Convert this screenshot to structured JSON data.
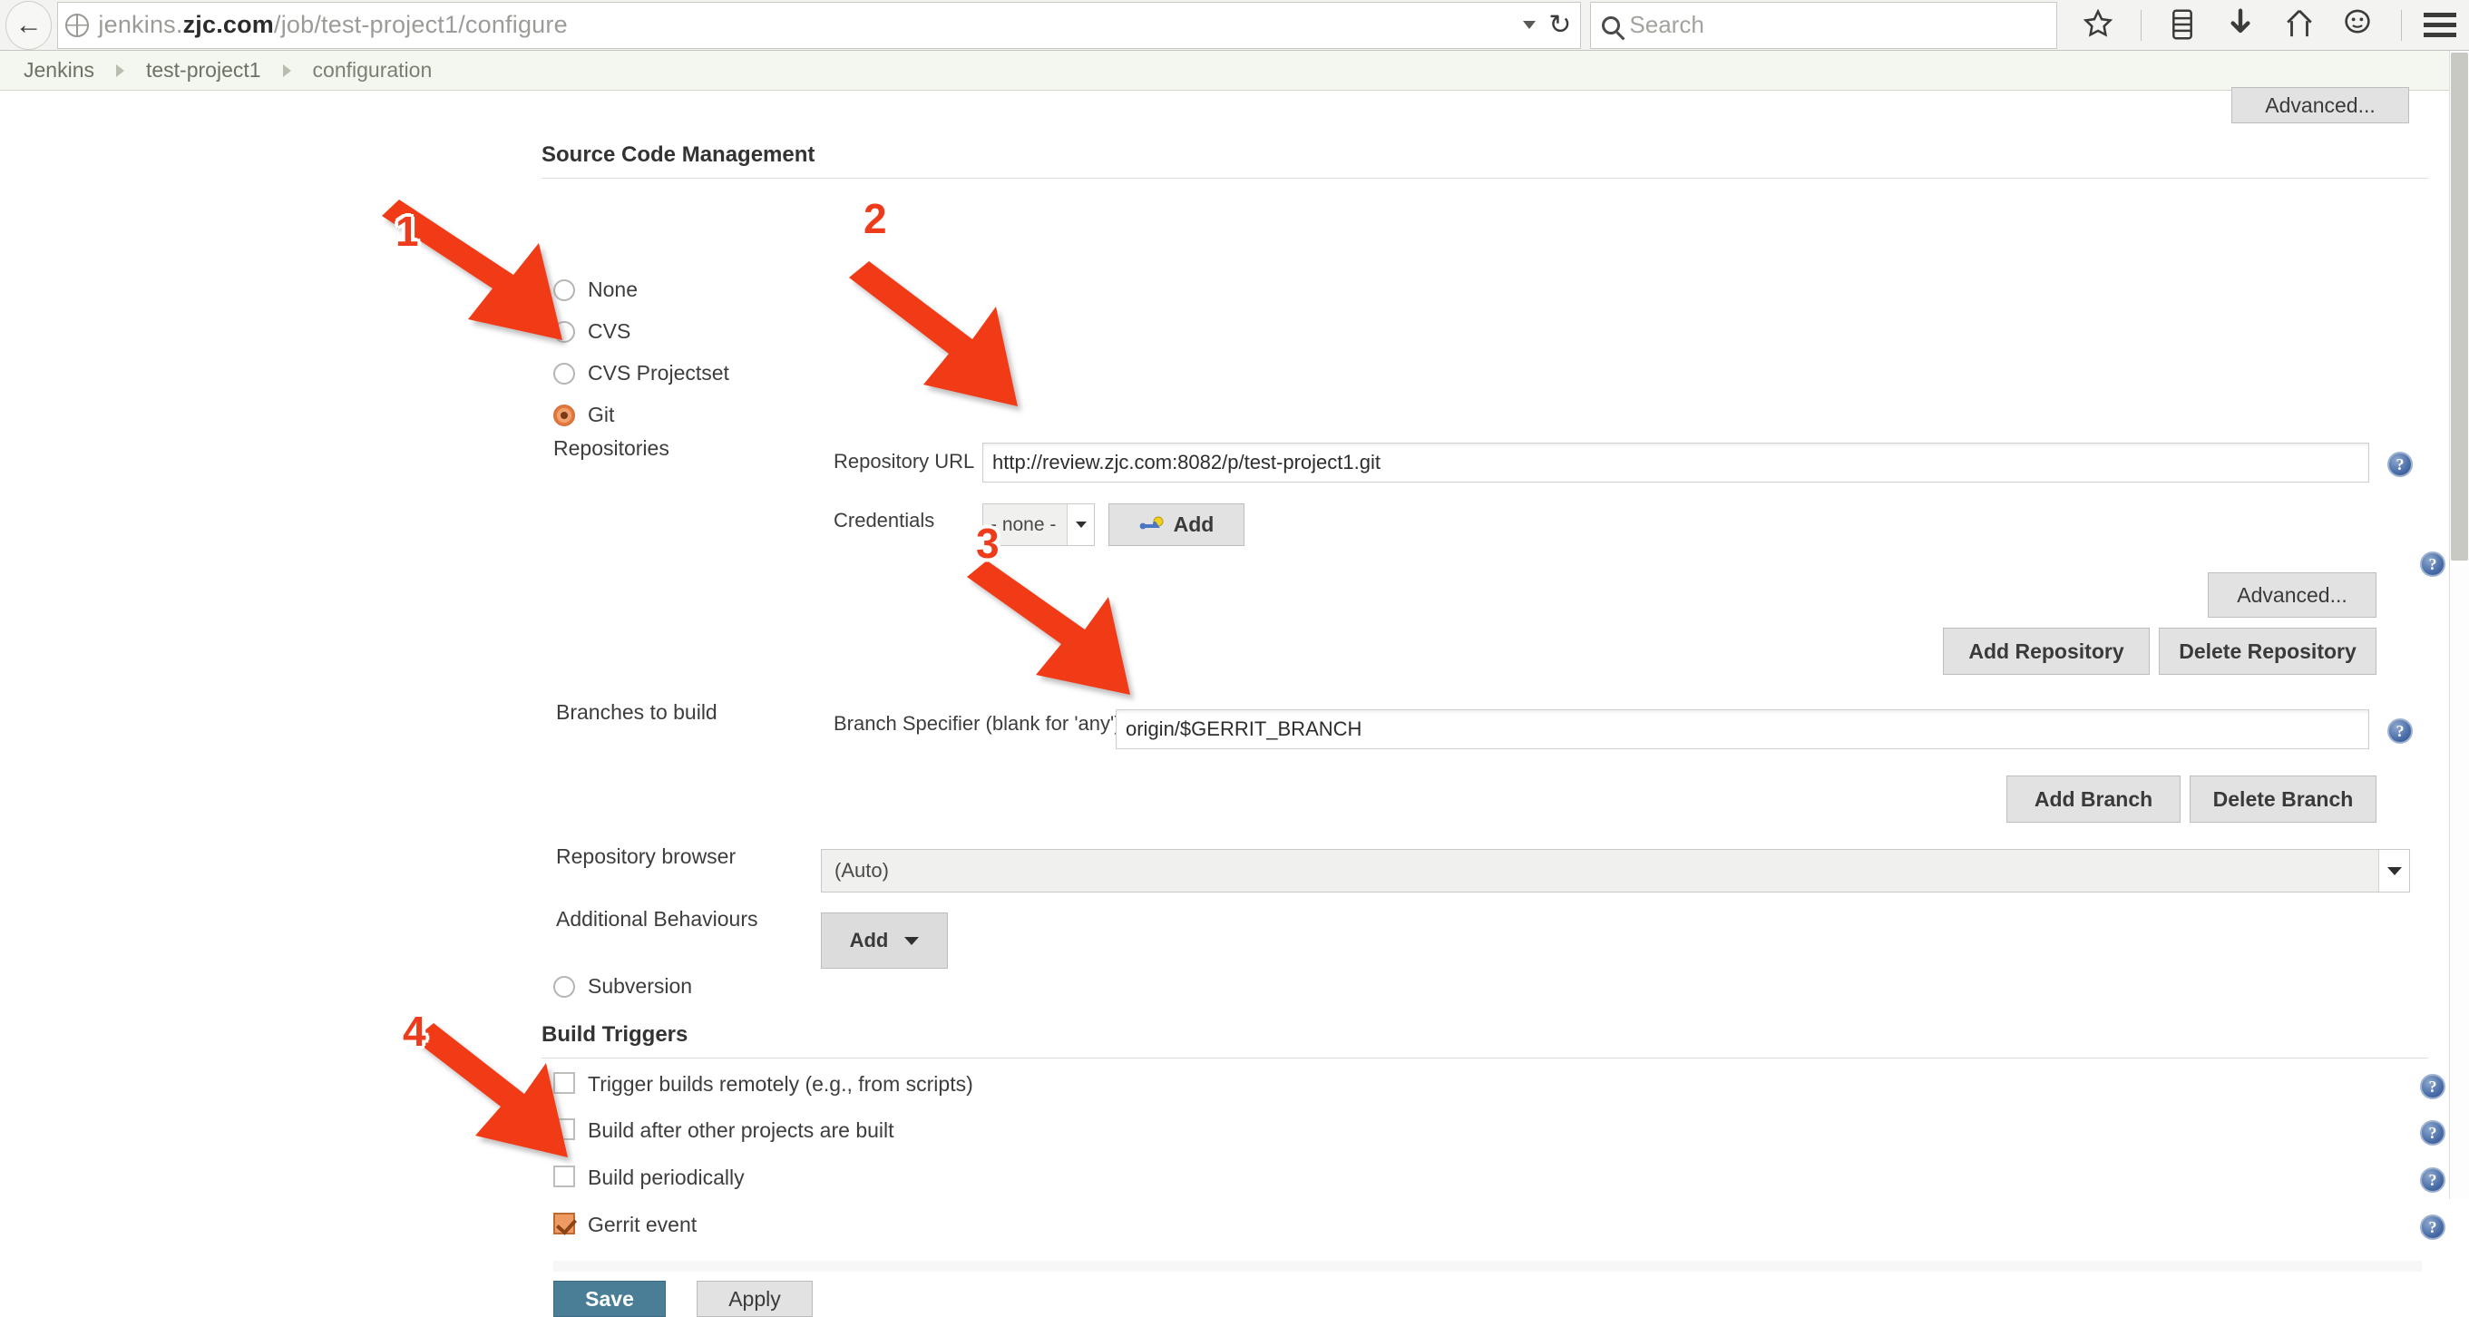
{
  "browser": {
    "back_icon": "back-arrow-icon",
    "site_icon": "globe-icon",
    "url_prefix": "jenkins.",
    "url_domain": "zjc.com",
    "url_path": "/job/test-project1/configure",
    "url_full": "jenkins.zjc.com/job/test-project1/configure",
    "dropdown_icon": "chevron-down-icon",
    "reload_icon": "reload-icon",
    "search_placeholder": "Search",
    "search_icon": "search-icon",
    "icons": [
      "bookmark-star-icon",
      "reading-list-icon",
      "downloads-icon",
      "home-icon",
      "chat-icon",
      "menu-hamburger-icon"
    ]
  },
  "breadcrumb": {
    "items": [
      {
        "label": "Jenkins"
      },
      {
        "label": "test-project1"
      },
      {
        "label": "configuration"
      }
    ],
    "separator_icon": "breadcrumb-chevron-icon"
  },
  "top_advanced_button": "Advanced...",
  "scm": {
    "heading": "Source Code Management",
    "options": [
      {
        "label": "None",
        "selected": false
      },
      {
        "label": "CVS",
        "selected": false
      },
      {
        "label": "CVS Projectset",
        "selected": false
      },
      {
        "label": "Git",
        "selected": true
      },
      {
        "label": "Subversion",
        "selected": false
      }
    ],
    "repositories_label": "Repositories",
    "repository_url_label": "Repository URL",
    "repository_url_value": "http://review.zjc.com:8082/p/test-project1.git",
    "credentials_label": "Credentials",
    "credentials_value": "- none -",
    "credentials_add_button": "Add",
    "credentials_add_icon": "key-icon",
    "advanced_button": "Advanced...",
    "add_repository_button": "Add Repository",
    "delete_repository_button": "Delete Repository",
    "branches_label": "Branches to build",
    "branch_specifier_label": "Branch Specifier (blank for 'any')",
    "branch_specifier_value": "origin/$GERRIT_BRANCH",
    "add_branch_button": "Add Branch",
    "delete_branch_button": "Delete Branch",
    "repository_browser_label": "Repository browser",
    "repository_browser_value": "(Auto)",
    "additional_behaviours_label": "Additional Behaviours",
    "additional_behaviours_button": "Add"
  },
  "build_triggers": {
    "heading": "Build Triggers",
    "items": [
      {
        "label": "Trigger builds remotely (e.g., from scripts)",
        "checked": false
      },
      {
        "label": "Build after other projects are built",
        "checked": false
      },
      {
        "label": "Build periodically",
        "checked": false
      },
      {
        "label": "Gerrit event",
        "checked": true
      }
    ]
  },
  "footer": {
    "save_button": "Save",
    "apply_button": "Apply"
  },
  "help_icon_label": "?",
  "annotations": [
    {
      "number": "1",
      "target": "git-radio"
    },
    {
      "number": "2",
      "target": "repository-url-input"
    },
    {
      "number": "3",
      "target": "branch-specifier-input"
    },
    {
      "number": "4",
      "target": "gerrit-event-checkbox"
    }
  ],
  "colors": {
    "annotation_red": "#ee3b1b",
    "accent_orange": "#e8793c",
    "primary_blue": "#4a7d96",
    "breadcrumb_bg": "#f4f7ef"
  }
}
